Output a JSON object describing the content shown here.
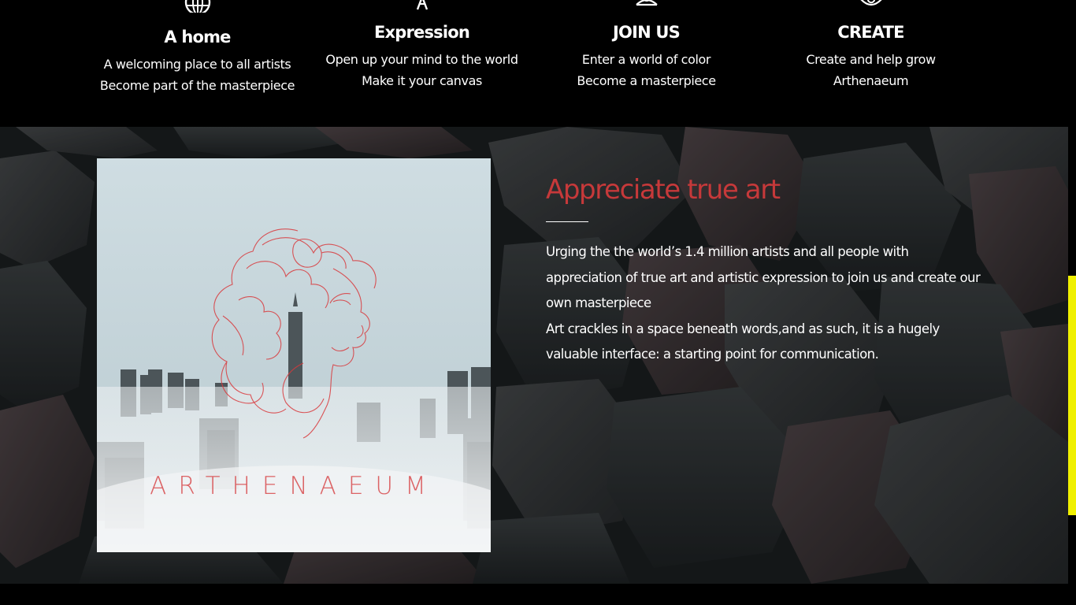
{
  "features": [
    {
      "icon": "globe-icon",
      "title": "A home",
      "lines": [
        "A welcoming place to all artists",
        "Become part of the masterpiece"
      ]
    },
    {
      "icon": "compass-icon",
      "title": "Expression",
      "lines": [
        "Open up your mind to the world",
        "Make it your canvas"
      ]
    },
    {
      "icon": "user-icon",
      "title": "JOIN US",
      "lines": [
        "Enter a world of color",
        "Become a masterpiece"
      ]
    },
    {
      "icon": "eye-icon",
      "title": "CREATE",
      "lines": [
        "Create and help grow",
        "Arthenaeum"
      ]
    }
  ],
  "about": {
    "image": {
      "wordmark": "ARTHENAEUM"
    },
    "heading": "Appreciate true art",
    "heading_color": "#c6393a",
    "paragraphs": [
      "Urging the the world’s 1.4 million artists and all people with appreciation of true art and artistic expression to join us and create our own masterpiece",
      "Art crackles in a space beneath words,and as such, it is a hugely valuable interface: a starting point for communication."
    ]
  },
  "colors": {
    "background": "#000000",
    "accent": "#c6393a",
    "scroll_marker": "#f0f000"
  }
}
